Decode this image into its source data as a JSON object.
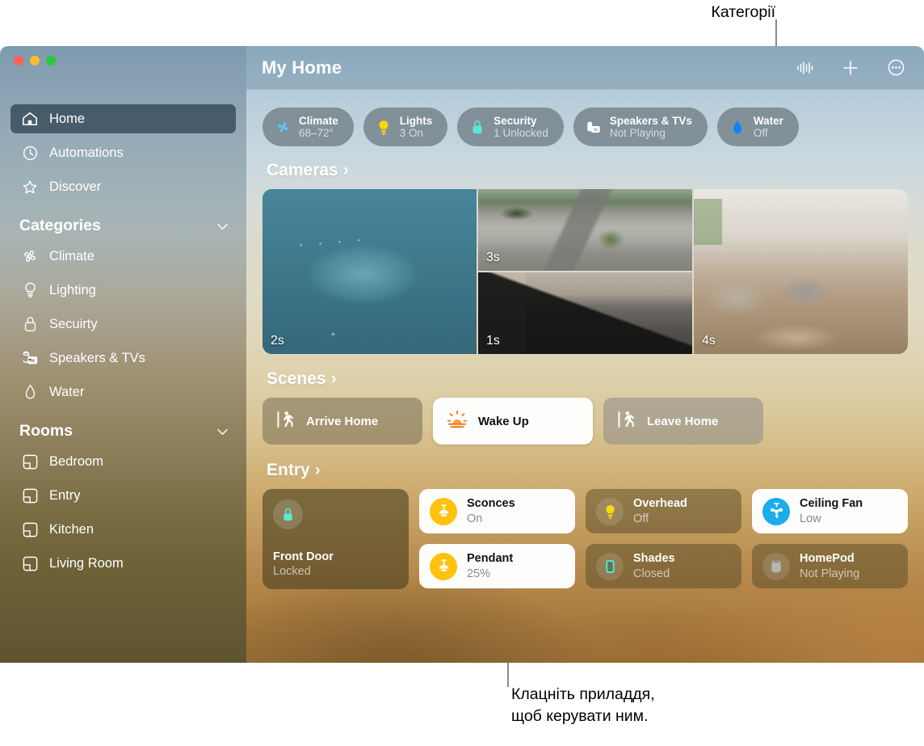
{
  "callouts": {
    "top": "Категорії",
    "bottom": "Клацніть приладдя,\nщоб керувати ним."
  },
  "window": {
    "title": "My Home"
  },
  "toolbar": {
    "buttons": [
      {
        "name": "audio-waveform-icon",
        "label": ""
      },
      {
        "name": "add-icon",
        "label": ""
      },
      {
        "name": "more-options-icon",
        "label": ""
      }
    ]
  },
  "sidebar": {
    "top_items": [
      {
        "label": "Home",
        "icon": "house-icon",
        "selected": true
      },
      {
        "label": "Automations",
        "icon": "clock-icon",
        "selected": false
      },
      {
        "label": "Discover",
        "icon": "star-icon",
        "selected": false
      }
    ],
    "groups": [
      {
        "title": "Categories",
        "items": [
          {
            "label": "Climate",
            "icon": "fan-icon"
          },
          {
            "label": "Lighting",
            "icon": "bulb-icon"
          },
          {
            "label": "Secuirty",
            "icon": "lock-icon"
          },
          {
            "label": "Speakers & TVs",
            "icon": "speaker-tv-icon"
          },
          {
            "label": "Water",
            "icon": "water-drop-icon"
          }
        ]
      },
      {
        "title": "Rooms",
        "items": [
          {
            "label": "Bedroom",
            "icon": "room-icon"
          },
          {
            "label": "Entry",
            "icon": "room-icon"
          },
          {
            "label": "Kitchen",
            "icon": "room-icon"
          },
          {
            "label": "Living Room",
            "icon": "room-icon"
          }
        ]
      }
    ]
  },
  "categories": [
    {
      "name": "Climate",
      "status": "68–72°",
      "icon": "fan-icon",
      "color": "#5ac8f5"
    },
    {
      "name": "Lights",
      "status": "3 On",
      "icon": "bulb-icon",
      "color": "#ffd60a"
    },
    {
      "name": "Security",
      "status": "1 Unlocked",
      "icon": "lock-icon",
      "color": "#5ce6d5"
    },
    {
      "name": "Speakers & TVs",
      "status": "Not Playing",
      "icon": "speaker-tv-icon",
      "color": "#ffffff"
    },
    {
      "name": "Water",
      "status": "Off",
      "icon": "water-drop-icon",
      "color": "#0a84ff"
    }
  ],
  "sections": {
    "cameras": {
      "title": "Cameras",
      "chevron": "›"
    },
    "scenes": {
      "title": "Scenes",
      "chevron": "›"
    },
    "entry": {
      "title": "Entry",
      "chevron": "›"
    }
  },
  "cameras": [
    {
      "name": "backyard-pool-camera",
      "timestamp": "2s"
    },
    {
      "name": "driveway-camera",
      "timestamp": "3s"
    },
    {
      "name": "garage-camera",
      "timestamp": "1s"
    },
    {
      "name": "living-room-camera",
      "timestamp": "4s"
    }
  ],
  "scenes": [
    {
      "label": "Arrive Home",
      "icon": "walking-figure-icon",
      "state": "off"
    },
    {
      "label": "Wake Up",
      "icon": "sunrise-icon",
      "state": "on"
    },
    {
      "label": "Leave Home",
      "icon": "walking-figure-icon",
      "state": "off"
    }
  ],
  "entry_accessories": {
    "lock": {
      "name": "Front Door",
      "status": "Locked",
      "icon": "lock-icon",
      "color": "#5ce6d5"
    },
    "tiles": [
      {
        "name": "Sconces",
        "status": "On",
        "icon": "sconce-lamp-icon",
        "state": "on",
        "swatch": "#ffc20e"
      },
      {
        "name": "Pendant",
        "status": "25%",
        "icon": "sconce-lamp-icon",
        "state": "on",
        "swatch": "#ffc20e"
      },
      {
        "name": "Overhead",
        "status": "Off",
        "icon": "bulb-icon",
        "state": "off",
        "swatch": "#ffd60a"
      },
      {
        "name": "Shades",
        "status": "Closed",
        "icon": "shade-icon",
        "state": "off",
        "swatch": "#5ce6d5"
      },
      {
        "name": "Ceiling Fan",
        "status": "Low",
        "icon": "ceiling-fan-icon",
        "state": "on",
        "swatch": "#1aacec"
      },
      {
        "name": "HomePod",
        "status": "Not Playing",
        "icon": "homepod-icon",
        "state": "off",
        "swatch": "#b5b5b5"
      }
    ]
  }
}
